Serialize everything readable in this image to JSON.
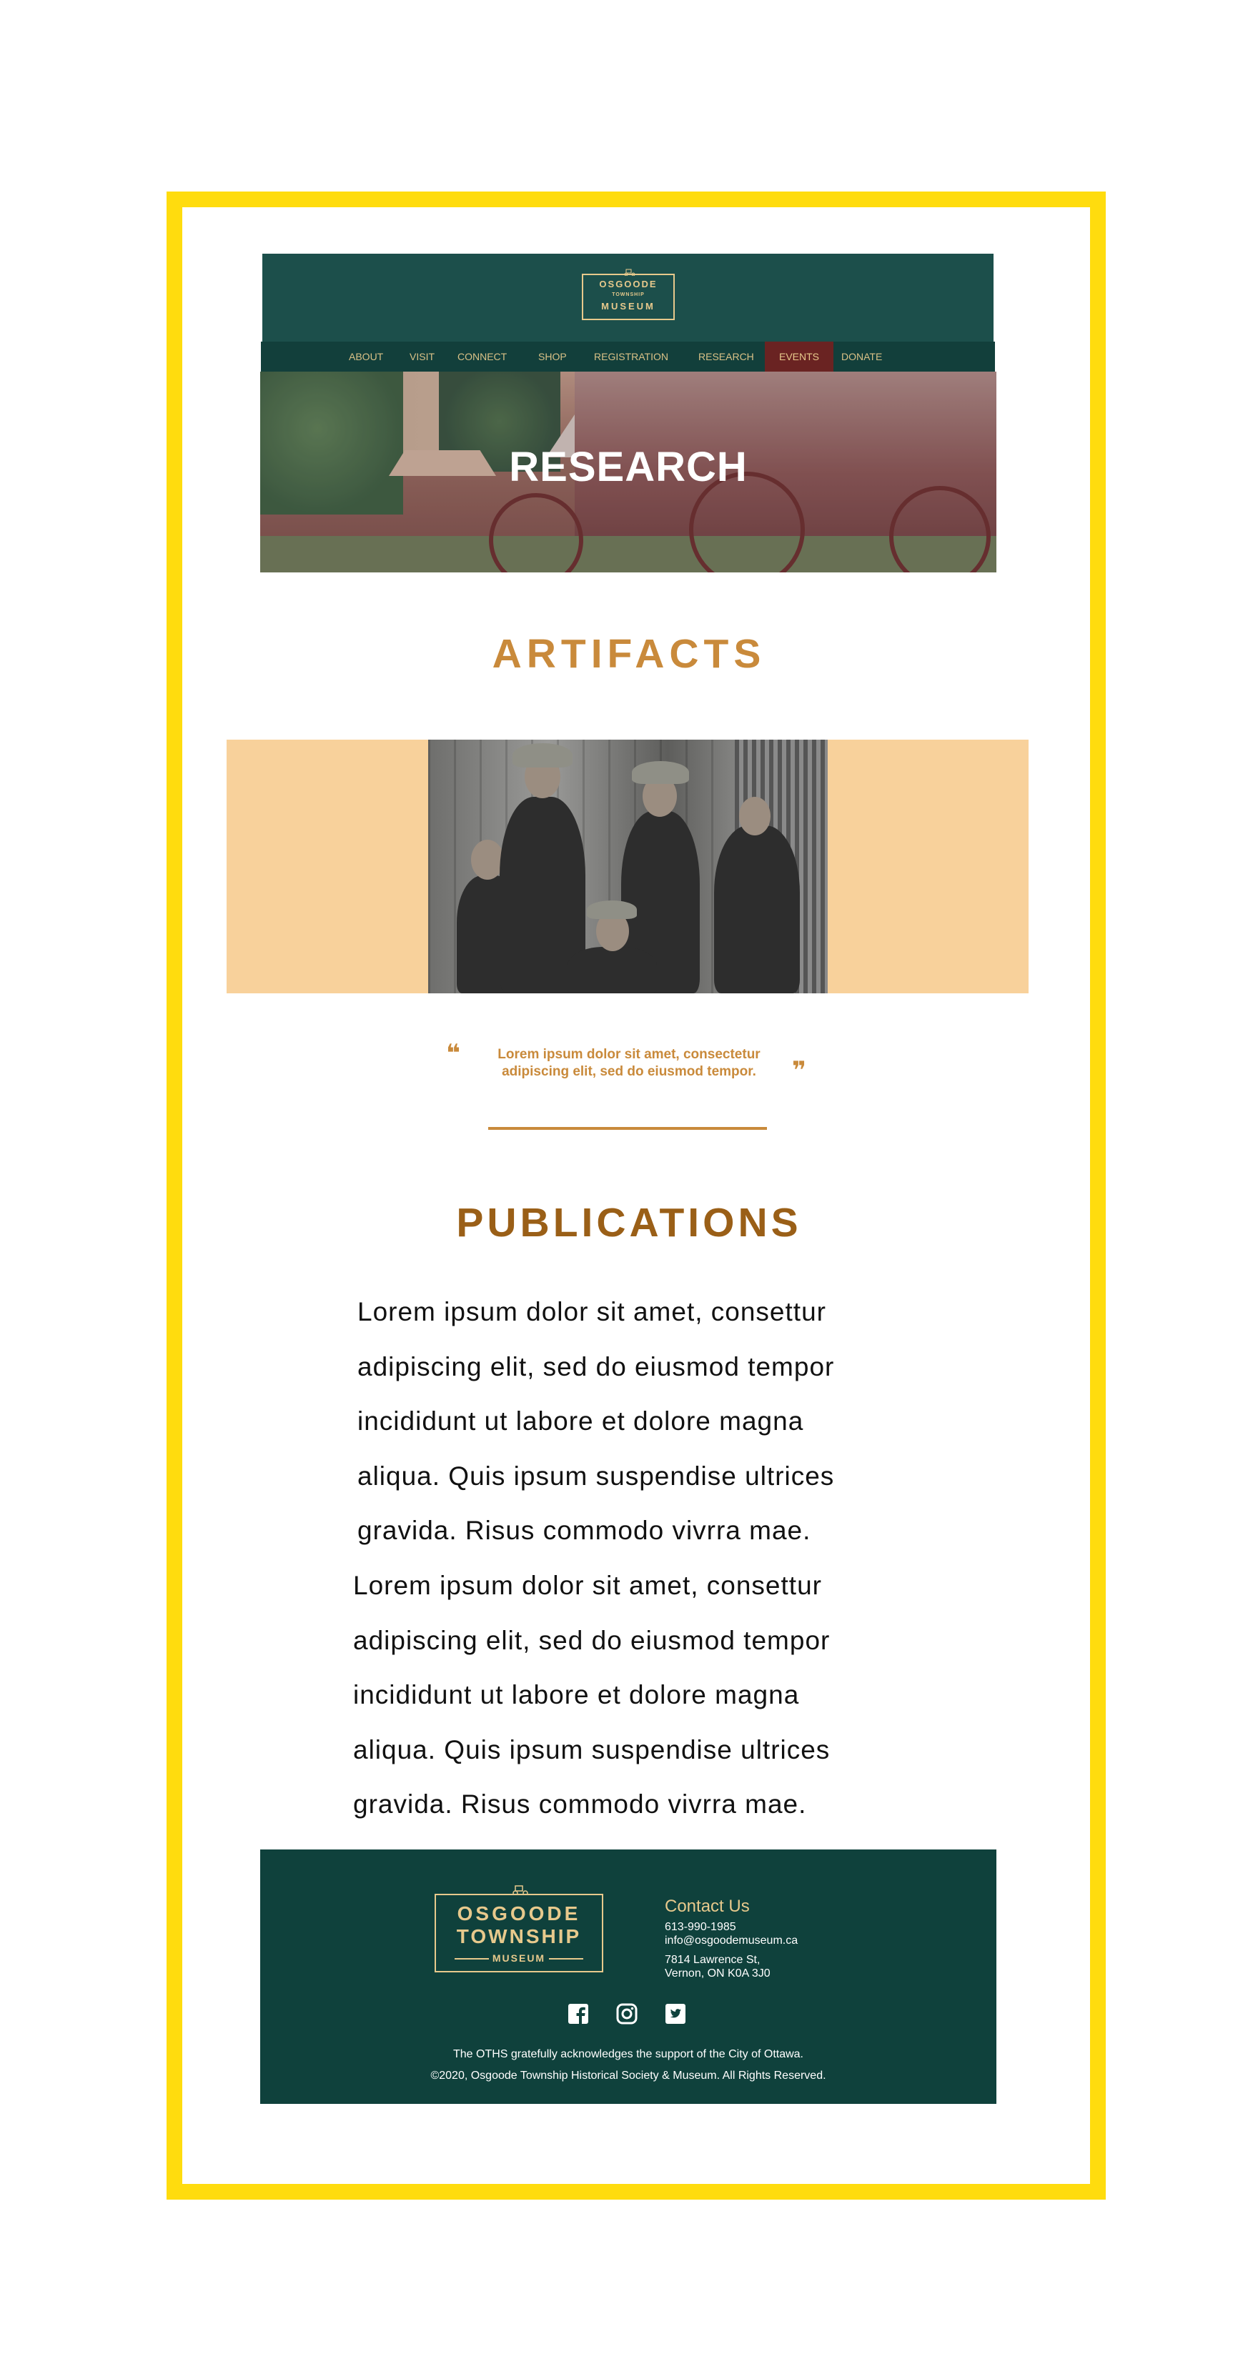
{
  "header": {
    "logo": {
      "line1": "OSGOODE",
      "line2": "TOWNSHIP",
      "line3": "MUSEUM"
    }
  },
  "nav": {
    "items": [
      {
        "label": "ABOUT"
      },
      {
        "label": "VISIT"
      },
      {
        "label": "CONNECT"
      },
      {
        "label": "SHOP"
      },
      {
        "label": "REGISTRATION"
      },
      {
        "label": "RESEARCH"
      },
      {
        "label": "EVENTS"
      },
      {
        "label": "DONATE"
      }
    ],
    "active": "EVENTS"
  },
  "hero": {
    "title": "RESEARCH"
  },
  "artifacts": {
    "title": "ARTIFACTS",
    "quote_line1": "Lorem ipsum dolor sit amet, consectetur",
    "quote_line2": "adipiscing elit, sed do eiusmod tempor.",
    "open_quote": "❝",
    "close_quote": "❞"
  },
  "publications": {
    "title": "PUBLICATIONS",
    "paragraph1": [
      "Lorem ipsum dolor sit amet, consettur",
      "adipiscing elit, sed do eiusmod tempor",
      "incididunt ut labore et dolore magna",
      "aliqua. Quis ipsum suspendise ultrices",
      "gravida. Risus commodo vivrra mae."
    ],
    "paragraph2": [
      "Lorem ipsum dolor sit amet, consettur",
      "adipiscing elit, sed do eiusmod tempor",
      "incididunt ut labore et dolore magna",
      "aliqua. Quis ipsum suspendise ultrices",
      "gravida. Risus commodo vivrra mae."
    ]
  },
  "footer": {
    "logo": {
      "line1": "OSGOODE",
      "line2": "TOWNSHIP",
      "line3": "MUSEUM"
    },
    "contact_title": "Contact Us",
    "phone": "613-990-1985",
    "email": "info@osgoodemuseum.ca",
    "address1": "7814 Lawrence St,",
    "address2": "Vernon, ON K0A 3J0",
    "social": [
      "facebook-icon",
      "instagram-icon",
      "twitter-icon"
    ],
    "ack": "The OTHS gratefully acknowledges the support of the City of Ottawa.",
    "copyright": "©2020, Osgoode Township Historical Society & Museum. All Rights Reserved."
  },
  "colors": {
    "frame": "#ffdc0e",
    "header": "#1c4f4b",
    "footer": "#0f413c",
    "accent": "#c98a3b",
    "band": "#f8d19b",
    "active_nav": "#6a2322"
  }
}
